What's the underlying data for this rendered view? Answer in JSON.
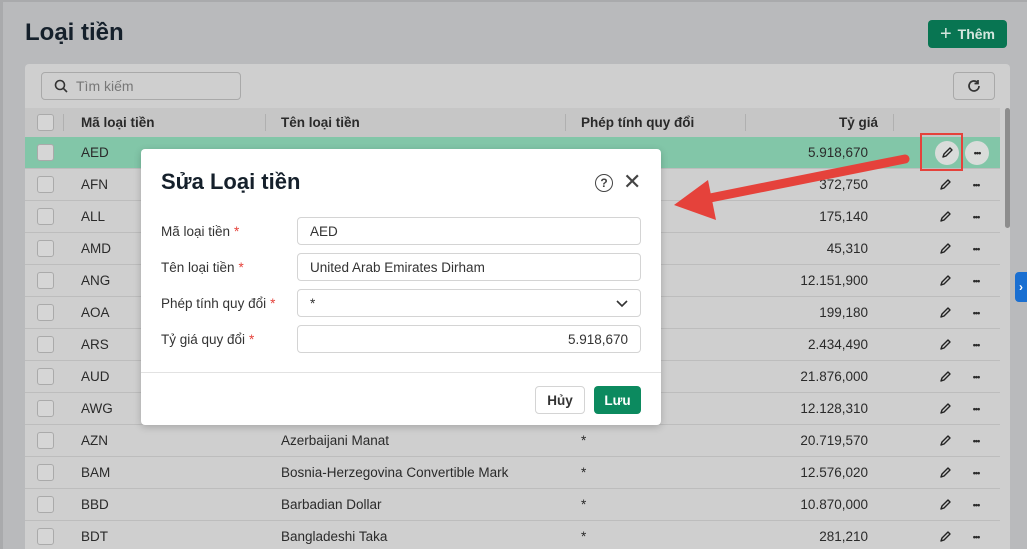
{
  "page": {
    "title": "Loại tiền",
    "add_label": "Thêm",
    "search_placeholder": "Tìm kiếm"
  },
  "table": {
    "headers": {
      "code": "Mã loại tiền",
      "name": "Tên loại tiền",
      "operation": "Phép tính quy đổi",
      "rate": "Tỷ giá"
    },
    "rows": [
      {
        "code": "AED",
        "name": "",
        "op": "",
        "rate": "5.918,670",
        "selected": true
      },
      {
        "code": "AFN",
        "name": "",
        "op": "",
        "rate": "372,750"
      },
      {
        "code": "ALL",
        "name": "",
        "op": "",
        "rate": "175,140"
      },
      {
        "code": "AMD",
        "name": "",
        "op": "",
        "rate": "45,310"
      },
      {
        "code": "ANG",
        "name": "",
        "op": "",
        "rate": "12.151,900"
      },
      {
        "code": "AOA",
        "name": "",
        "op": "",
        "rate": "199,180"
      },
      {
        "code": "ARS",
        "name": "",
        "op": "",
        "rate": "2.434,490"
      },
      {
        "code": "AUD",
        "name": "",
        "op": "",
        "rate": "21.876,000"
      },
      {
        "code": "AWG",
        "name": "",
        "op": "",
        "rate": "12.128,310"
      },
      {
        "code": "AZN",
        "name": "Azerbaijani Manat",
        "op": "*",
        "rate": "20.719,570"
      },
      {
        "code": "BAM",
        "name": "Bosnia-Herzegovina Convertible Mark",
        "op": "*",
        "rate": "12.576,020"
      },
      {
        "code": "BBD",
        "name": "Barbadian Dollar",
        "op": "*",
        "rate": "10.870,000"
      },
      {
        "code": "BDT",
        "name": "Bangladeshi Taka",
        "op": "*",
        "rate": "281,210"
      }
    ]
  },
  "modal": {
    "title": "Sửa Loại tiền",
    "fields": [
      {
        "label": "Mã loại tiền",
        "value": "AED"
      },
      {
        "label": "Tên loại tiền",
        "value": "United Arab Emirates Dirham"
      },
      {
        "label": "Phép tính quy đổi",
        "value": "*"
      },
      {
        "label": "Tỷ giá quy đổi",
        "value": "5.918,670"
      }
    ],
    "required_mark": "*",
    "cancel_label": "Hủy",
    "save_label": "Lưu"
  },
  "colors": {
    "accent": "#087552",
    "highlight": "#e5423b",
    "selected_row": "#82c6a8"
  }
}
